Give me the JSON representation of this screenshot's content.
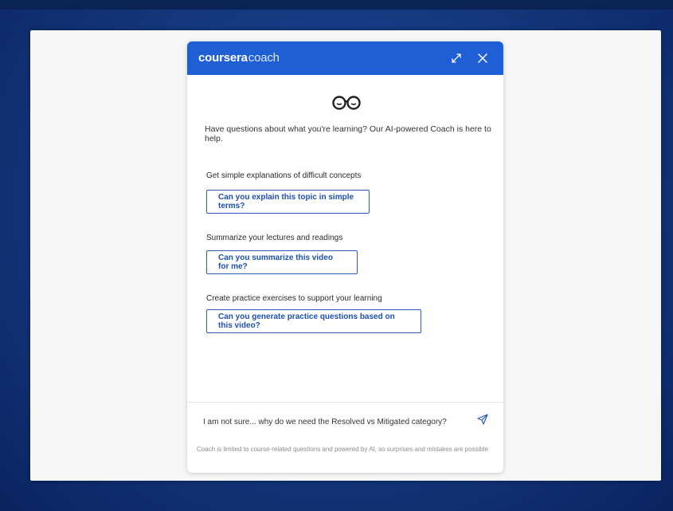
{
  "header": {
    "brand_main": "coursera",
    "brand_sub": "coach",
    "expand_icon": "expand-icon",
    "close_icon": "close-icon",
    "color": "#1f5fd6"
  },
  "intro_text": "Have questions about what you're learning? Our AI-powered Coach is here to help.",
  "sections": [
    {
      "label": "Get simple explanations of difficult concepts",
      "button": "Can you explain this topic in simple terms?"
    },
    {
      "label": "Summarize your lectures and readings",
      "button": "Can you summarize this video for me?"
    },
    {
      "label": "Create practice exercises to support your learning",
      "button": "Can you generate practice questions based on this video?"
    }
  ],
  "composer": {
    "value": "I am not sure... why do we need the Resolved vs Mitigated category?",
    "send_icon": "send-icon"
  },
  "disclaimer": "Coach is limited to course-related questions and powered by AI, so surprises and mistakes are possible"
}
